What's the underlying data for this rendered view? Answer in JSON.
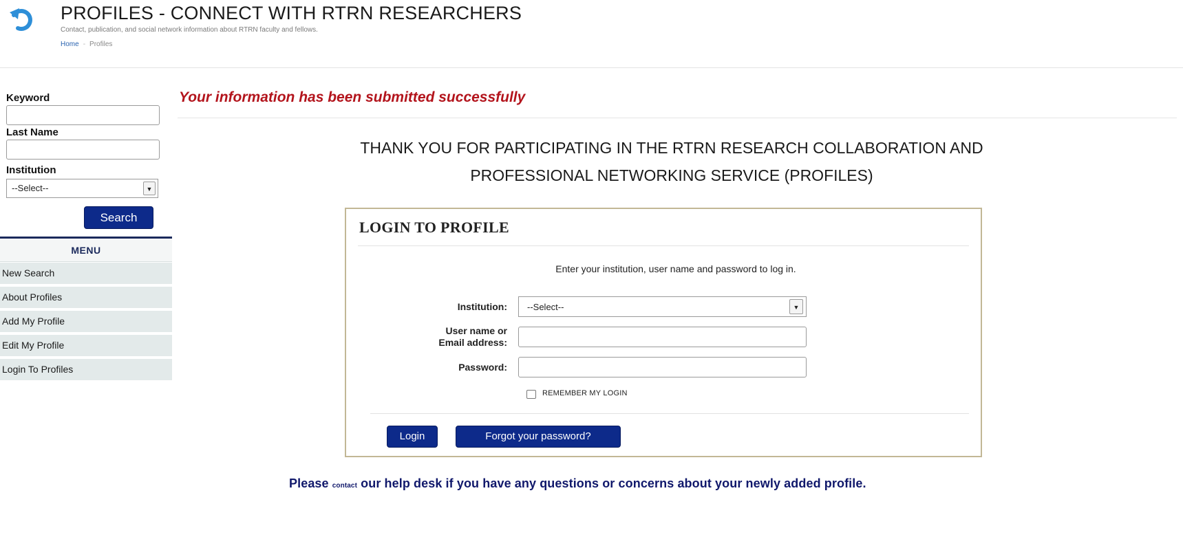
{
  "header": {
    "title": "PROFILES - CONNECT WITH RTRN RESEARCHERS",
    "subtitle": "Contact, publication, and social network information about RTRN faculty and fellows.",
    "breadcrumb": {
      "home": "Home",
      "separator": "-",
      "current": "Profiles"
    },
    "logo_icon": "back-arrow-icon"
  },
  "sidebar": {
    "keyword_label": "Keyword",
    "keyword_value": "",
    "lastname_label": "Last Name",
    "lastname_value": "",
    "institution_label": "Institution",
    "institution_selected": "--Select--",
    "search_label": "Search",
    "menu": {
      "title": "MENU",
      "items": [
        {
          "label": "New Search"
        },
        {
          "label": "About Profiles"
        },
        {
          "label": "Add My Profile"
        },
        {
          "label": "Edit My Profile"
        },
        {
          "label": "Login To Profiles"
        }
      ]
    }
  },
  "main": {
    "success_message": "Your information has been submitted successfully",
    "thank_you_line1": "THANK YOU FOR PARTICIPATING IN THE RTRN RESEARCH COLLABORATION AND",
    "thank_you_line2": "PROFESSIONAL NETWORKING SERVICE (PROFILES)",
    "login": {
      "title": "LOGIN TO PROFILE",
      "instructions": "Enter your institution, user name and password to log in.",
      "institution_label": "Institution:",
      "institution_selected": "--Select--",
      "username_label_line1": "User name or",
      "username_label_line2": "Email address:",
      "username_value": "",
      "password_label": "Password:",
      "password_value": "",
      "remember_label": "REMEMBER MY LOGIN",
      "remember_checked": false,
      "login_button": "Login",
      "forgot_button": "Forgot your password?"
    },
    "help": {
      "before": "Please ",
      "link": "contact",
      "after": " our help desk if you have any questions or concerns about your newly added profile."
    }
  },
  "colors": {
    "button_blue": "#0d2a8a",
    "success_red": "#b3141c",
    "help_navy": "#10186b",
    "menu_bg": "#e3eaea",
    "login_border": "#c2b795",
    "logo_blue": "#2e8fd8"
  }
}
